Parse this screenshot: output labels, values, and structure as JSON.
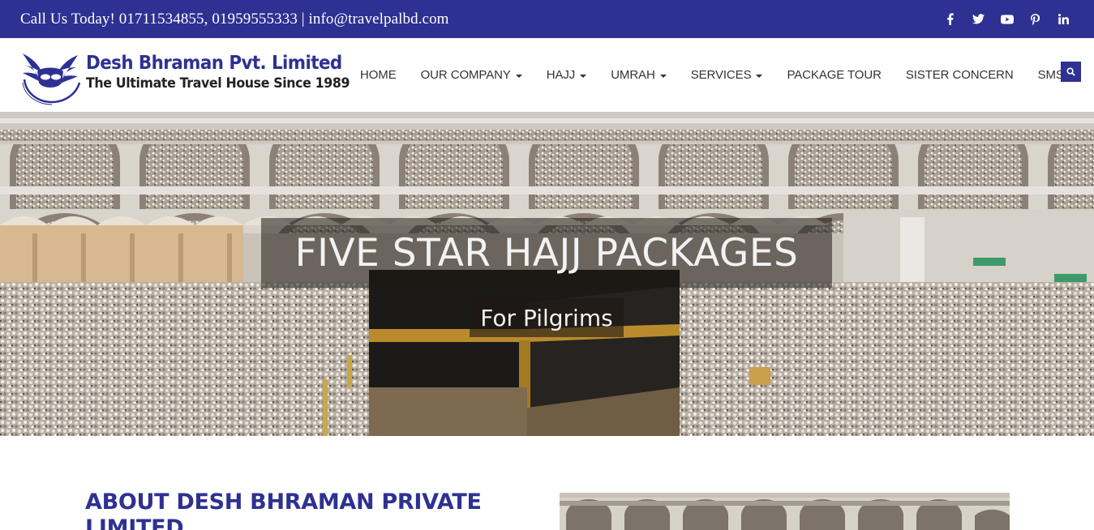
{
  "topbar": {
    "contact": "Call Us Today! 01711534855, 01959555333 | info@travelpalbd.com",
    "social": [
      "facebook-icon",
      "twitter-icon",
      "youtube-icon",
      "pinterest-icon",
      "linkedin-icon"
    ]
  },
  "brand": {
    "name": "Desh Bhraman Pvt. Limited",
    "tagline": "The Ultimate Travel House Since 1989",
    "seal_text": "Desh Bhraman (Pvt.) Limited"
  },
  "nav": {
    "items": [
      {
        "label": "HOME",
        "dropdown": false
      },
      {
        "label": "OUR COMPANY",
        "dropdown": true
      },
      {
        "label": "HAJJ",
        "dropdown": true
      },
      {
        "label": "UMRAH",
        "dropdown": true
      },
      {
        "label": "SERVICES",
        "dropdown": true
      },
      {
        "label": "PACKAGE TOUR",
        "dropdown": false
      },
      {
        "label": "SISTER CONCERN",
        "dropdown": false
      },
      {
        "label": "SMS",
        "dropdown": false
      }
    ]
  },
  "hero": {
    "title": "FIVE STAR HAJJ PACKAGES",
    "subtitle": "For Pilgrims"
  },
  "about": {
    "title": "ABOUT DESH BHRAMAN PRIVATE LIMITED"
  },
  "colors": {
    "brand_blue": "#2e3192",
    "topbar_bg": "#2e3192"
  }
}
